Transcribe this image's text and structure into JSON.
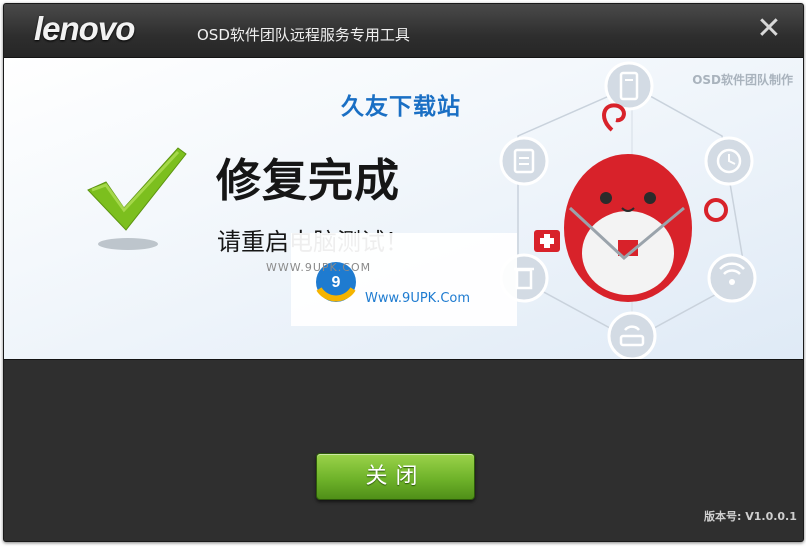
{
  "titlebar": {
    "logo": "lenovo",
    "title": "OSD软件团队远程服务专用工具",
    "close_glyph": "✕"
  },
  "content": {
    "credit": "OSD软件团队制作",
    "heading": "修复完成",
    "message": "请重启电脑测试！"
  },
  "watermark": {
    "small_text": "WWW.9UPK.COM",
    "brand": "久友下载站",
    "url": "Www.9UPK.Com"
  },
  "footer": {
    "close_button": "关闭",
    "version": "版本号: V1.0.0.1"
  },
  "icons": [
    "phone-icon",
    "clipboard-icon",
    "clock-icon",
    "trash-icon",
    "wifi-icon",
    "router-icon",
    "first-aid-icon",
    "check-icon",
    "mascot-icon"
  ],
  "colors": {
    "accent_green": "#6fb32a",
    "check_green": "#7cbf1e",
    "mascot_red": "#d8222a"
  }
}
